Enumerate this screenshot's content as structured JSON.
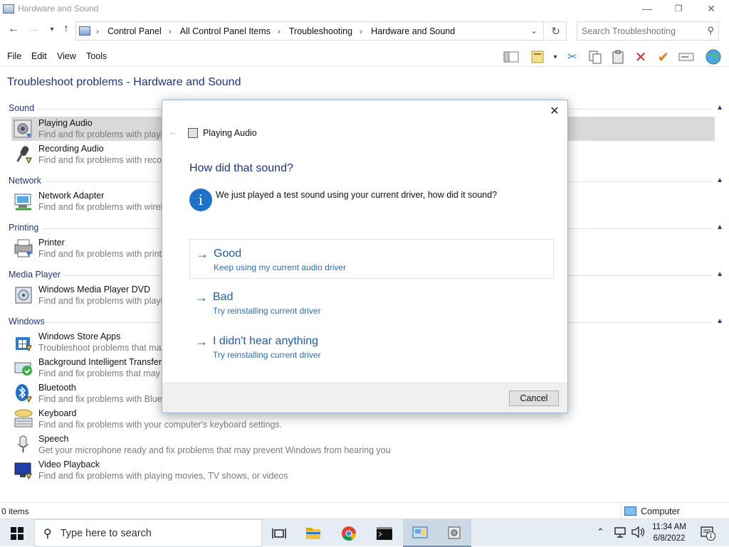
{
  "window": {
    "title": "Hardware and Sound",
    "minimize": "—",
    "maximize": "❐",
    "close": "✕"
  },
  "address": {
    "crumbs": [
      "Control Panel",
      "All Control Panel Items",
      "Troubleshooting",
      "Hardware and Sound"
    ],
    "search_placeholder": "Search Troubleshooting"
  },
  "menu": [
    "File",
    "Edit",
    "View",
    "Tools"
  ],
  "page_title": "Troubleshoot problems - Hardware and Sound",
  "categories": [
    {
      "name": "Sound",
      "items": [
        {
          "name": "Playing Audio",
          "desc": "Find and fix problems with playing sound",
          "selected": true
        },
        {
          "name": "Recording Audio",
          "desc": "Find and fix problems with recording sound"
        }
      ]
    },
    {
      "name": "Network",
      "items": [
        {
          "name": "Network Adapter",
          "desc": "Find and fix problems with wireless and other network adapters"
        }
      ]
    },
    {
      "name": "Printing",
      "items": [
        {
          "name": "Printer",
          "desc": "Find and fix problems with printing"
        }
      ]
    },
    {
      "name": "Media Player",
      "items": [
        {
          "name": "Windows Media Player DVD",
          "desc": "Find and fix problems with playing DVDs in Windows Media Player"
        }
      ]
    },
    {
      "name": "Windows",
      "items": [
        {
          "name": "Windows Store Apps",
          "desc": "Troubleshoot problems that may prevent Windows Store Apps from working properly"
        },
        {
          "name": "Background Intelligent Transfer Service",
          "desc": "Find and fix problems that may prevent background downloads from working"
        },
        {
          "name": "Bluetooth",
          "desc": "Find and fix problems with Bluetooth devices"
        },
        {
          "name": "Keyboard",
          "desc": "Find and fix problems with your computer's keyboard settings."
        },
        {
          "name": "Speech",
          "desc": "Get your microphone ready and fix problems that may prevent Windows from hearing you"
        },
        {
          "name": "Video Playback",
          "desc": "Find and fix problems with playing movies, TV shows, or videos"
        }
      ]
    }
  ],
  "status": {
    "items": "0 items",
    "location": "Computer"
  },
  "dialog": {
    "title": "Playing Audio",
    "heading": "How did that sound?",
    "info": "We just played a test sound using your current driver, how did it sound?",
    "options": [
      {
        "label": "Good",
        "sub": "Keep using my current audio driver"
      },
      {
        "label": "Bad",
        "sub": "Try reinstalling current driver"
      },
      {
        "label": "I didn't hear anything",
        "sub": "Try reinstalling current driver"
      }
    ],
    "cancel": "Cancel"
  },
  "taskbar": {
    "search_placeholder": "Type here to search",
    "time": "11:34 AM",
    "date": "6/8/2022",
    "notification_count": "1"
  },
  "colors": {
    "heading_blue": "#1e3287",
    "link_blue": "#1e5ea8",
    "selection": "#d9d9d9",
    "taskbar": "#e6ecf3"
  }
}
